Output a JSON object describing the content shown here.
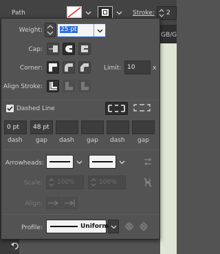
{
  "control_bar": {
    "path_label": "Path",
    "stroke_label": "Stroke:",
    "stroke_value_partial": "2",
    "behind_tab_partial": "GB/G"
  },
  "panel": {
    "weight": {
      "label": "Weight:",
      "value": "25 pt"
    },
    "cap": {
      "label": "Cap:"
    },
    "corner": {
      "label": "Corner:",
      "limit_label": "Limit:",
      "limit_value": "10",
      "limit_unit": "x"
    },
    "align_stroke": {
      "label": "Align Stroke:"
    },
    "dashed": {
      "label": "Dashed Line",
      "checked": true,
      "values": [
        "0 pt",
        "48 pt",
        "",
        "",
        "",
        ""
      ],
      "captions": [
        "dash",
        "gap",
        "dash",
        "gap",
        "dash",
        "gap"
      ]
    },
    "arrowheads": {
      "label": "Arrowheads:"
    },
    "scale": {
      "label": "Scale:",
      "start": "100%",
      "end": "100%"
    },
    "align": {
      "label": "Align:"
    },
    "profile": {
      "label": "Profile:",
      "value": "Uniform"
    }
  }
}
